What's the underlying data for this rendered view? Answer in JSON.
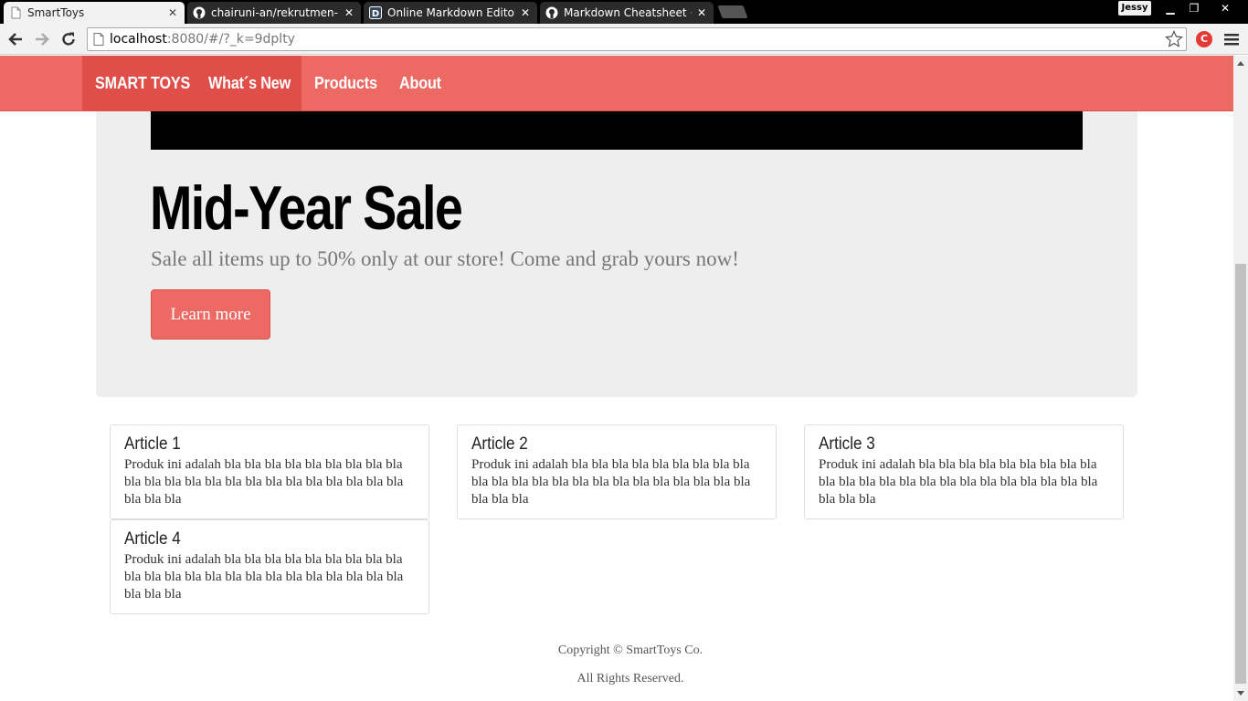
{
  "browser": {
    "tabs": [
      {
        "title": "SmartToys",
        "icon": "page-icon",
        "active": true
      },
      {
        "title": "chairuni-an/rekrutmen-lab",
        "icon": "github-icon",
        "active": false
      },
      {
        "title": "Online Markdown Editor - ",
        "icon": "dillinger-icon",
        "active": false
      },
      {
        "title": "Markdown Cheatsheet · a",
        "icon": "github-icon",
        "active": false
      }
    ],
    "profile_name": "Jessy",
    "url_host": "localhost",
    "url_path": ":8080/#/?_k=9dplty",
    "extension_label": "C"
  },
  "navbar": {
    "brand": "SMART TOYS",
    "items": [
      "What´s New",
      "Products",
      "About"
    ],
    "colors": {
      "bar": "#ec6964",
      "active": "#e04e49"
    }
  },
  "hero": {
    "title": "Mid-Year Sale",
    "subtitle": "Sale all items up to 50% only at our store! Come and grab yours now!",
    "button_label": "Learn more"
  },
  "articles": [
    {
      "title": "Article 1",
      "body": "Produk ini adalah bla bla bla bla bla bla bla bla bla bla bla bla bla bla bla bla bla bla bla bla bla bla bla bla bla bla"
    },
    {
      "title": "Article 2",
      "body": "Produk ini adalah bla bla bla bla bla bla bla bla bla bla bla bla bla bla bla bla bla bla bla bla bla bla bla bla bla bla"
    },
    {
      "title": "Article 3",
      "body": "Produk ini adalah bla bla bla bla bla bla bla bla bla bla bla bla bla bla bla bla bla bla bla bla bla bla bla bla bla bla"
    },
    {
      "title": "Article 4",
      "body": "Produk ini adalah bla bla bla bla bla bla bla bla bla bla bla bla bla bla bla bla bla bla bla bla bla bla bla bla bla bla"
    }
  ],
  "footer": {
    "copyright": "Copyright © SmartToys Co.",
    "rights": "All Rights Reserved."
  }
}
